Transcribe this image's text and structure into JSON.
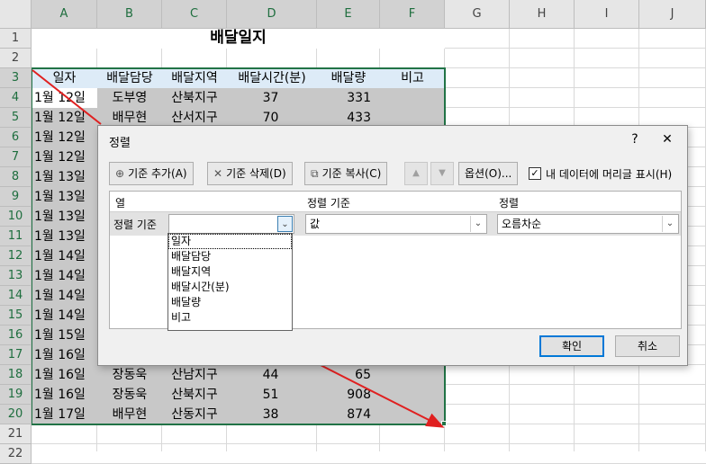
{
  "sheet": {
    "col_headers": [
      "A",
      "B",
      "C",
      "D",
      "E",
      "F",
      "G",
      "H",
      "I",
      "J"
    ],
    "row_headers": [
      "1",
      "2",
      "3",
      "4",
      "5",
      "6",
      "7",
      "8",
      "9",
      "10",
      "11",
      "12",
      "13",
      "14",
      "15",
      "16",
      "17",
      "18",
      "19",
      "20",
      "21",
      "22"
    ],
    "title": "배달일지",
    "table_headers": [
      "일자",
      "배달담당",
      "배달지역",
      "배달시간(분)",
      "배달량",
      "비고"
    ],
    "visible_rows": {
      "r4": [
        "1월 12일",
        "도부영",
        "산북지구",
        "37",
        "331",
        ""
      ],
      "r5": [
        "1월 12일",
        "배무현",
        "산서지구",
        "70",
        "433",
        ""
      ],
      "r6": [
        "1월 12일"
      ],
      "r7": [
        "1월 12일"
      ],
      "r8": [
        "1월 13일"
      ],
      "r9": [
        "1월 13일"
      ],
      "r10": [
        "1월 13일"
      ],
      "r11": [
        "1월 13일"
      ],
      "r12": [
        "1월 14일"
      ],
      "r13": [
        "1월 14일"
      ],
      "r14": [
        "1월 14일"
      ],
      "r15": [
        "1월 14일"
      ],
      "r16": [
        "1월 15일"
      ],
      "r17": [
        "1월 16일"
      ],
      "r18": [
        "1월 16일",
        "장동욱",
        "산남지구",
        "44",
        "65",
        ""
      ],
      "r19": [
        "1월 16일",
        "장동욱",
        "산북지구",
        "51",
        "908",
        ""
      ],
      "r20": [
        "1월 17일",
        "배무현",
        "산동지구",
        "38",
        "874",
        ""
      ]
    }
  },
  "dialog": {
    "title": "정렬",
    "help": "?",
    "close": "✕",
    "toolbar": {
      "add_label": "기준 추가(A)",
      "delete_label": "기준 삭제(D)",
      "copy_label": "기준 복사(C)",
      "options_label": "옵션(O)...",
      "header_checkbox_label": "내 데이터에 머리글 표시(H)",
      "header_checked": true
    },
    "columns": {
      "col_label": "열",
      "sort_on_label": "정렬 기준",
      "order_label": "정렬"
    },
    "row": {
      "label": "정렬 기준",
      "column_value": "",
      "sort_on_value": "값",
      "order_value": "오름차순"
    },
    "dropdown_options": [
      "일자",
      "배달담당",
      "배달지역",
      "배달시간(분)",
      "배달량",
      "비고"
    ],
    "ok_label": "확인",
    "cancel_label": "취소"
  },
  "colors": {
    "accent": "#217346",
    "selection_fill": "#c6c6c6",
    "header_fill": "#ddebf7",
    "arrow": "#e02020",
    "dialog_focus": "#0078d7"
  }
}
